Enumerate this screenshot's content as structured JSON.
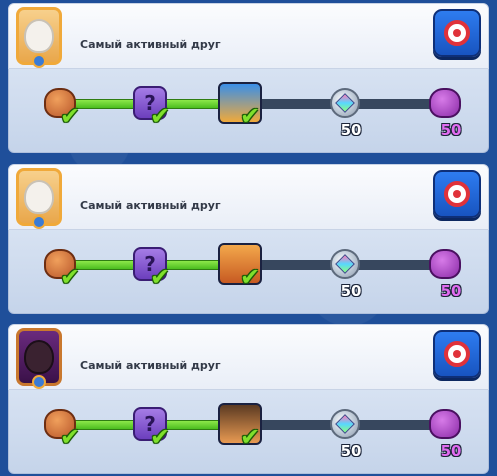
{
  "colors": {
    "background": "#1f4f9a",
    "progress_fill": "#6ad12e",
    "progress_track": "#37475e",
    "button_blue": "#2e7cf0",
    "check_green": "#7fe02c",
    "count_purple": "#e06cf0"
  },
  "cards": [
    {
      "friend_name": "Самый активный друг",
      "avatar_icon": "hero-portrait-icon",
      "action_icon": "target-icon",
      "progress": 0.5,
      "rewards": [
        {
          "icon": "coin-bag-icon",
          "claimed": true,
          "count": ""
        },
        {
          "icon": "mystery-puzzle-icon",
          "claimed": true,
          "count": ""
        },
        {
          "icon": "hero-card-icon",
          "claimed": true,
          "count": ""
        },
        {
          "icon": "gem-icon",
          "claimed": false,
          "count": "50"
        },
        {
          "icon": "purple-bag-icon",
          "claimed": false,
          "count": "50"
        }
      ]
    },
    {
      "friend_name": "Самый активный друг",
      "avatar_icon": "hero-portrait-icon",
      "action_icon": "target-icon",
      "progress": 0.5,
      "rewards": [
        {
          "icon": "coin-bag-icon",
          "claimed": true,
          "count": ""
        },
        {
          "icon": "mystery-puzzle-icon",
          "claimed": true,
          "count": ""
        },
        {
          "icon": "fist-card-icon",
          "claimed": true,
          "count": ""
        },
        {
          "icon": "gem-icon",
          "claimed": false,
          "count": "50"
        },
        {
          "icon": "purple-bag-icon",
          "claimed": false,
          "count": "50"
        }
      ]
    },
    {
      "friend_name": "Самый активный друг",
      "avatar_icon": "bat-portrait-icon",
      "action_icon": "target-icon",
      "progress": 0.5,
      "rewards": [
        {
          "icon": "coin-bag-icon",
          "claimed": true,
          "count": ""
        },
        {
          "icon": "mystery-puzzle-icon",
          "claimed": true,
          "count": ""
        },
        {
          "icon": "pirate-card-icon",
          "claimed": true,
          "count": ""
        },
        {
          "icon": "gem-icon",
          "claimed": false,
          "count": "50"
        },
        {
          "icon": "purple-bag-icon",
          "claimed": false,
          "count": "50"
        }
      ]
    }
  ]
}
